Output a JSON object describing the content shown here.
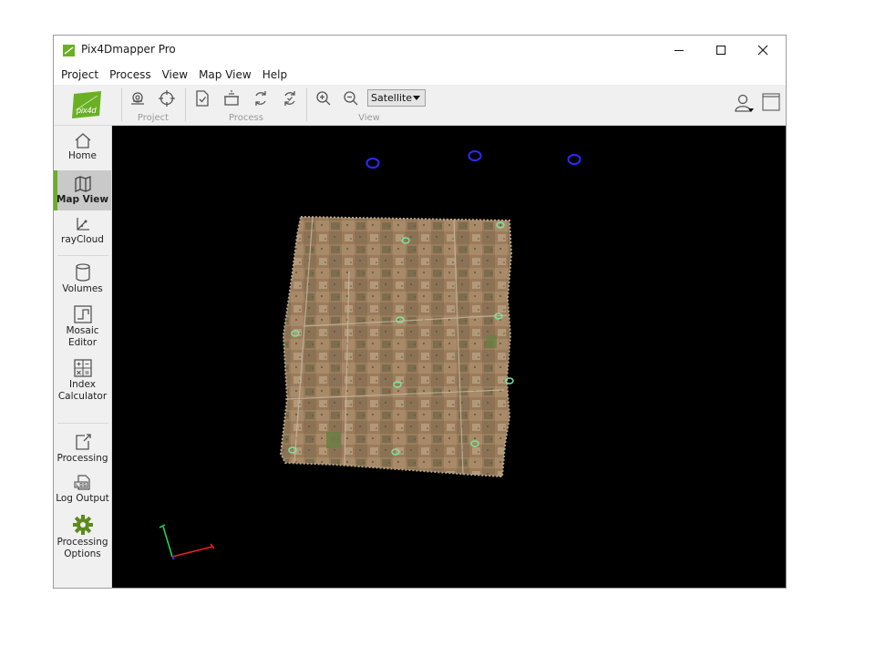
{
  "window": {
    "title": "Pix4Dmapper Pro"
  },
  "menu": [
    "Project",
    "Process",
    "View",
    "Map View",
    "Help"
  ],
  "logo": {
    "text": "pix4d",
    "color": "#6ab023"
  },
  "toolbar": {
    "groups": [
      {
        "label": "Project",
        "icons": [
          "camera-center-icon",
          "target-icon"
        ]
      },
      {
        "label": "Process",
        "icons": [
          "process-check-icon",
          "open-box-icon",
          "refresh-icon",
          "rerun-icon"
        ]
      },
      {
        "label": "View",
        "icons": [
          "zoom-in-icon",
          "zoom-out-icon"
        ]
      }
    ],
    "basemap": {
      "selected": "Satellite"
    }
  },
  "sidebar": {
    "items": [
      {
        "label": "Home",
        "icon": "home-icon",
        "active": false
      },
      {
        "label": "Map View",
        "icon": "map-icon",
        "active": true
      },
      {
        "label": "rayCloud",
        "icon": "raycloud-icon",
        "active": false
      },
      {
        "label": "Volumes",
        "icon": "volumes-icon",
        "active": false
      },
      {
        "label": "Mosaic Editor",
        "icon": "mosaic-editor-icon",
        "active": false
      },
      {
        "label": "Index Calculator",
        "icon": "index-calculator-icon",
        "active": false
      },
      {
        "label": "Processing",
        "icon": "processing-icon",
        "active": false
      },
      {
        "label": "Log Output",
        "icon": "log-output-icon",
        "active": false
      },
      {
        "label": "Processing Options",
        "icon": "gear-icon",
        "active": false
      }
    ]
  },
  "colors": {
    "accent": "#6ab023",
    "viewport_bg": "#000000",
    "gcp_marker": "#2a2aff",
    "tie_point": "#7de3a0"
  }
}
